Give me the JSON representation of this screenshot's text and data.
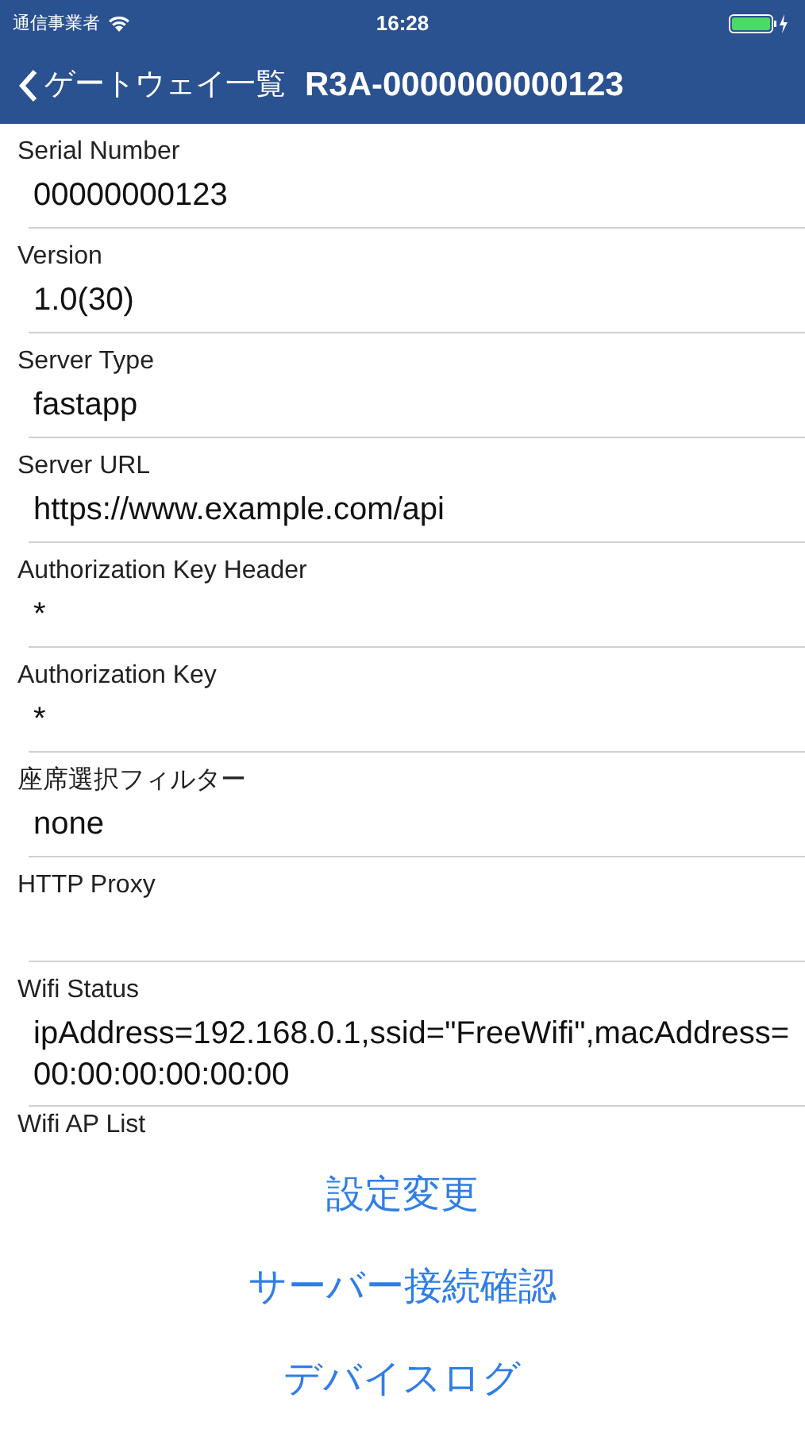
{
  "status_bar": {
    "carrier": "通信事業者",
    "time": "16:28"
  },
  "nav": {
    "back": "ゲートウェイ一覧",
    "title": "R3A-0000000000123"
  },
  "fields": [
    {
      "label": "Serial Number",
      "value": "00000000123"
    },
    {
      "label": "Version",
      "value": "1.0(30)"
    },
    {
      "label": "Server Type",
      "value": "fastapp"
    },
    {
      "label": "Server URL",
      "value": "https://www.example.com/api"
    },
    {
      "label": "Authorization Key Header",
      "value": "*"
    },
    {
      "label": "Authorization Key",
      "value": "*"
    },
    {
      "label": "座席選択フィルター",
      "value": "none"
    },
    {
      "label": "HTTP Proxy"
    },
    {
      "label": "Wifi Status",
      "value": "ipAddress=192.168.0.1,ssid=\"FreeWifi\",macAddress=00:00:00:00:00:00"
    },
    {
      "label": "Wifi AP List"
    }
  ],
  "actions": [
    "設定変更",
    "サーバー接続確認",
    "デバイスログ"
  ]
}
